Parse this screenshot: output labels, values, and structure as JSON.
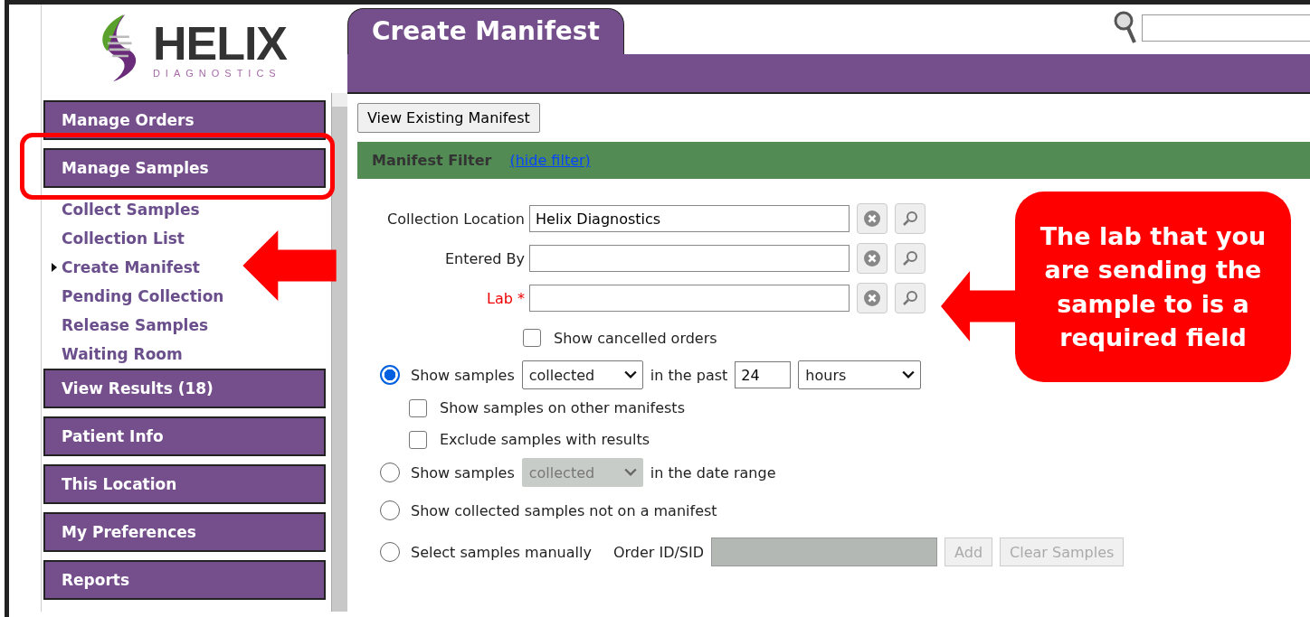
{
  "logo": {
    "name": "HELIX",
    "tagline": "DIAGNOSTICS"
  },
  "header": {
    "tab": "Create Manifest"
  },
  "sidebar": {
    "sections": [
      {
        "label": "Manage Orders"
      },
      {
        "label": "Manage Samples",
        "children": [
          {
            "label": "Collect Samples",
            "selected": false
          },
          {
            "label": "Collection List",
            "selected": false
          },
          {
            "label": "Create Manifest",
            "selected": true
          },
          {
            "label": "Pending Collection",
            "selected": false
          },
          {
            "label": "Release Samples",
            "selected": false
          },
          {
            "label": "Waiting Room",
            "selected": false
          }
        ]
      },
      {
        "label": "View Results (18)"
      },
      {
        "label": "Patient Info"
      },
      {
        "label": "This Location"
      },
      {
        "label": "My Preferences"
      },
      {
        "label": "Reports"
      }
    ]
  },
  "toolbar": {
    "button": "View Existing Manifest"
  },
  "filter": {
    "title": "Manifest Filter",
    "link": "(hide filter)"
  },
  "fields": [
    {
      "label": "Collection Location",
      "value": "Helix Diagnostics",
      "required": false
    },
    {
      "label": "Entered By",
      "required": false
    },
    {
      "label": "Lab",
      "required": true,
      "required_mark": "*"
    }
  ],
  "show_cancelled": {
    "label": "Show cancelled orders",
    "checked": false
  },
  "options": [
    {
      "kind": "past",
      "selected": true,
      "label": "Show samples",
      "select": "collected",
      "select_disabled": false,
      "text": "in the past",
      "count": "24",
      "unit": "hours",
      "checks": [
        {
          "label": "Show samples on other manifests",
          "checked": false
        },
        {
          "label": "Exclude samples with results",
          "checked": false
        }
      ]
    },
    {
      "kind": "range",
      "selected": false,
      "label": "Show samples",
      "select": "collected",
      "select_disabled": true,
      "text": "in the date range"
    },
    {
      "kind": "plain",
      "selected": false,
      "label": "Show collected samples not on a manifest"
    },
    {
      "kind": "manual",
      "selected": false,
      "label": "Select samples manually",
      "field_label": "Order ID/SID",
      "disabled": true,
      "buttons": [
        "Add",
        "Clear Samples"
      ]
    }
  ],
  "annotation": {
    "callout": "The lab that you are sending the sample to is a required field"
  }
}
